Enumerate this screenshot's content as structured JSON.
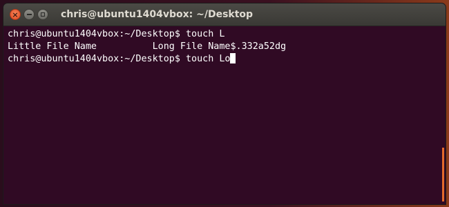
{
  "window": {
    "title": "chris@ubuntu1404vbox: ~/Desktop",
    "close_glyph": "×",
    "accent_close": "#e0461c"
  },
  "terminal": {
    "background": "#300a24",
    "lines": [
      "chris@ubuntu1404vbox:~/Desktop$ touch L",
      "Little File Name          Long File Name$.332a52dg",
      "chris@ubuntu1404vbox:~/Desktop$ touch Lo"
    ]
  },
  "icons": {
    "close": "close-icon",
    "minimize": "minimize-icon",
    "maximize": "maximize-icon"
  }
}
